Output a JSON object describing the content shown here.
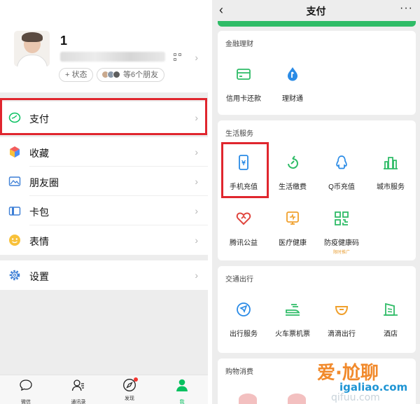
{
  "colors": {
    "brand_green": "#07c160",
    "highlight_red": "#e0262e",
    "panel_bg": "#ededed"
  },
  "me": {
    "nickname": "1",
    "status_label": "+ 状态",
    "friends_label": "等6个朋友"
  },
  "menu": {
    "items": [
      {
        "label": "支付",
        "icon": "wallet-icon"
      },
      {
        "label": "收藏",
        "icon": "favorites-cube-icon"
      },
      {
        "label": "朋友圈",
        "icon": "moments-image-icon"
      },
      {
        "label": "卡包",
        "icon": "card-wallet-icon"
      },
      {
        "label": "表情",
        "icon": "sticker-smile-icon"
      },
      {
        "label": "设置",
        "icon": "gear-icon"
      }
    ]
  },
  "tabbar": {
    "tabs": [
      {
        "label": "微信",
        "icon": "chat-bubble-icon"
      },
      {
        "label": "通讯录",
        "icon": "contacts-icon"
      },
      {
        "label": "发现",
        "icon": "compass-icon"
      },
      {
        "label": "我",
        "icon": "person-icon",
        "active": true
      }
    ]
  },
  "pay": {
    "title": "支付",
    "back_icon": "chevron-left-icon",
    "more_label": "···",
    "sections": [
      {
        "title": "金融理财",
        "items": [
          {
            "label": "信用卡还款",
            "icon": "credit-card-icon"
          },
          {
            "label": "理财通",
            "icon": "drop-icon"
          }
        ]
      },
      {
        "title": "生活服务",
        "items": [
          {
            "label": "手机充值",
            "icon": "phone-icon"
          },
          {
            "label": "生活缴费",
            "icon": "leaf-icon"
          },
          {
            "label": "Q币充值",
            "icon": "penguin-icon"
          },
          {
            "label": "城市服务",
            "icon": "city-icon"
          },
          {
            "label": "腾讯公益",
            "icon": "heart-icon"
          },
          {
            "label": "医疗健康",
            "icon": "medical-icon"
          },
          {
            "label": "防疫健康码",
            "icon": "qr-code-icon",
            "sub": "限时推广"
          }
        ]
      },
      {
        "title": "交通出行",
        "items": [
          {
            "label": "出行服务",
            "icon": "navigation-icon"
          },
          {
            "label": "火车票机票",
            "icon": "train-icon"
          },
          {
            "label": "滴滴出行",
            "icon": "didi-icon"
          },
          {
            "label": "酒店",
            "icon": "hotel-icon"
          }
        ]
      },
      {
        "title": "购物消费",
        "items": []
      }
    ]
  },
  "watermark": {
    "brand": "爱·尬聊",
    "url": "igaliao.com",
    "ghost": "qifuu.com"
  }
}
